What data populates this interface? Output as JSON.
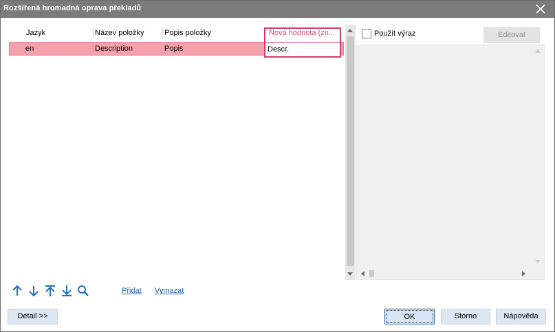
{
  "window": {
    "title": "Rozšířená hromadná oprava překladů"
  },
  "grid": {
    "columns": [
      "Jazyk",
      "Název položky",
      "Popis položky",
      "Nová hodnota (zn..."
    ],
    "rows": [
      {
        "jazyk": "en",
        "nazev": "Description",
        "popis": "Popis",
        "nova_hodnota": "Descr."
      }
    ]
  },
  "expression": {
    "checkbox_label": "Použít výraz",
    "checked": false,
    "edit_button": "Editovat"
  },
  "toolbar": {
    "icons": [
      "arrow-up-icon",
      "arrow-down-icon",
      "arrow-to-top-icon",
      "arrow-to-bottom-icon",
      "search-icon"
    ],
    "add_link": "Přidat",
    "delete_link": "Vymazat"
  },
  "buttons": {
    "detail": "Detail >>",
    "ok": "OK",
    "cancel": "Storno",
    "help": "Nápověda"
  },
  "colors": {
    "titlebar": "#7b7b7b",
    "selected_row": "#f5a1ad",
    "focus_border": "#d7396a",
    "active_header": "#e64b6a",
    "link": "#1f5fb0",
    "icon": "#1f6fc5",
    "button": "#dde7f3"
  }
}
